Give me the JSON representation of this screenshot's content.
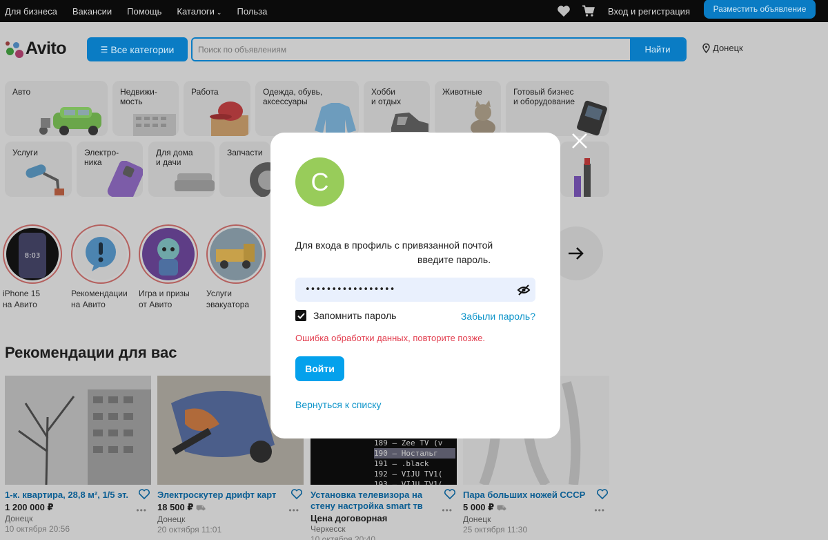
{
  "topbar": {
    "nav": [
      "Для бизнеса",
      "Вакансии",
      "Помощь",
      "Каталоги",
      "Польза"
    ],
    "login": "Вход и регистрация",
    "post_ad": "Разместить объявление"
  },
  "header": {
    "logo": "Avito",
    "categories_button": "Все категории",
    "search_placeholder": "Поиск по объявлениям",
    "search_button": "Найти",
    "location": "Донецк"
  },
  "categories": [
    {
      "label": "Авто"
    },
    {
      "label": "Недвижи-\nмость"
    },
    {
      "label": "Работа"
    },
    {
      "label": "Одежда, обувь,\nаксессуары"
    },
    {
      "label": "Хобби\nи отдых"
    },
    {
      "label": "Животные"
    },
    {
      "label": "Готовый бизнес\nи оборудование"
    },
    {
      "label": "Услуги"
    },
    {
      "label": "Электро-\nника"
    },
    {
      "label": "Для дома\nи дачи"
    },
    {
      "label": "Запчасти"
    }
  ],
  "stories": [
    {
      "label": "iPhone 15\nна Авито"
    },
    {
      "label": "Рекомендации\nна Авито"
    },
    {
      "label": "Игра и призы\nот Авито"
    },
    {
      "label": "Услуги\nэвакуатора"
    }
  ],
  "recommendations": {
    "title": "Рекомендации для вас",
    "cards": [
      {
        "title": "1-к. квартира, 28,8 м², 1/5 эт.",
        "price": "1 200 000 ₽",
        "city": "Донецк",
        "date": "10 октября 20:56"
      },
      {
        "title": "Электроскутер дрифт карт",
        "price": "18 500 ₽",
        "city": "Донецк",
        "date": "20 октября 11:01"
      },
      {
        "title": "Установка телевизора на стену настройка smart тв",
        "price": "Цена договорная",
        "city": "Черкесск",
        "date": "10 октября 20:40"
      },
      {
        "title": "Пара больших ножей СССР",
        "price": "5 000 ₽",
        "city": "Донецк",
        "date": "25 октября 11:30"
      }
    ],
    "tv_list": [
      "189 — Zee TV (v",
      "190 — Ностальг",
      "191 — .black",
      "192 — VIJU TV1(",
      "193 — VIJU TV1("
    ]
  },
  "modal": {
    "avatar_letter": "С",
    "message_line1": "Для входа в профиль с привязанной почтой",
    "message_line2": "введите пароль.",
    "password_value": "•••••••••••••••••",
    "remember_label": "Запомнить пароль",
    "remember_checked": true,
    "forgot_link": "Забыли пароль?",
    "error": "Ошибка обработки данных, повторите позже.",
    "submit": "Войти",
    "back_link": "Вернуться к списку"
  },
  "colors": {
    "brand_blue": "#0a7cc4",
    "link_blue": "#0b93c9",
    "button_blue": "#04a1ec",
    "error_red": "#e23d4e",
    "avatar_green": "#98cc5a"
  }
}
